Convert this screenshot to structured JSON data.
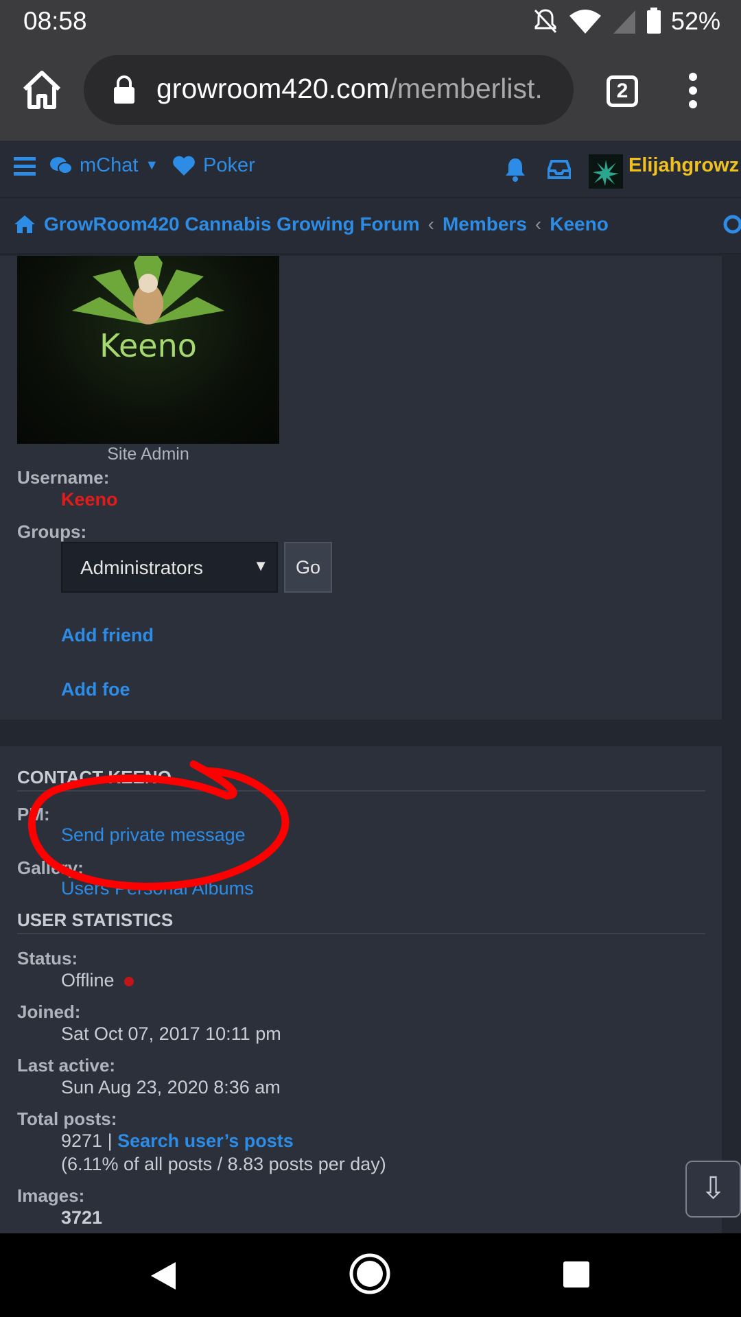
{
  "status_bar": {
    "time": "08:58",
    "battery": "52%"
  },
  "browser": {
    "url_host": "growroom420.com",
    "url_path": "/memberlist.",
    "tab_count": "2"
  },
  "forum_nav": {
    "mchat": "mChat",
    "poker": "Poker",
    "username": "Elijahgrowz"
  },
  "breadcrumbs": {
    "home": "GrowRoom420 Cannabis Growing Forum",
    "members": "Members",
    "user": "Keeno"
  },
  "profile": {
    "avatar_text": "Keeno",
    "rank": "Site Admin",
    "username_label": "Username:",
    "username": "Keeno",
    "groups_label": "Groups:",
    "group_selected": "Administrators",
    "go_label": "Go",
    "add_friend": "Add friend",
    "add_foe": "Add foe"
  },
  "contact": {
    "title": "CONTACT KEENO",
    "pm_label": "PM:",
    "pm_link": "Send private message",
    "gallery_label": "Gallery:",
    "gallery_link": "Users Personal Albums"
  },
  "stats": {
    "title": "USER STATISTICS",
    "status_label": "Status:",
    "status": "Offline",
    "joined_label": "Joined:",
    "joined": "Sat Oct 07, 2017 10:11 pm",
    "last_active_label": "Last active:",
    "last_active": "Sun Aug 23, 2020 8:36 am",
    "total_posts_label": "Total posts:",
    "total_posts": "9271 |",
    "search_posts": "Search user’s posts",
    "posts_detail": "(6.11% of all posts / 8.83 posts per day)",
    "images_label": "Images:",
    "images": "3721"
  },
  "colors": {
    "accent_link": "#2d8ce6",
    "username_gold": "#f0c020",
    "admin_red": "#e21b1b",
    "annotation_red": "#ff0000"
  }
}
